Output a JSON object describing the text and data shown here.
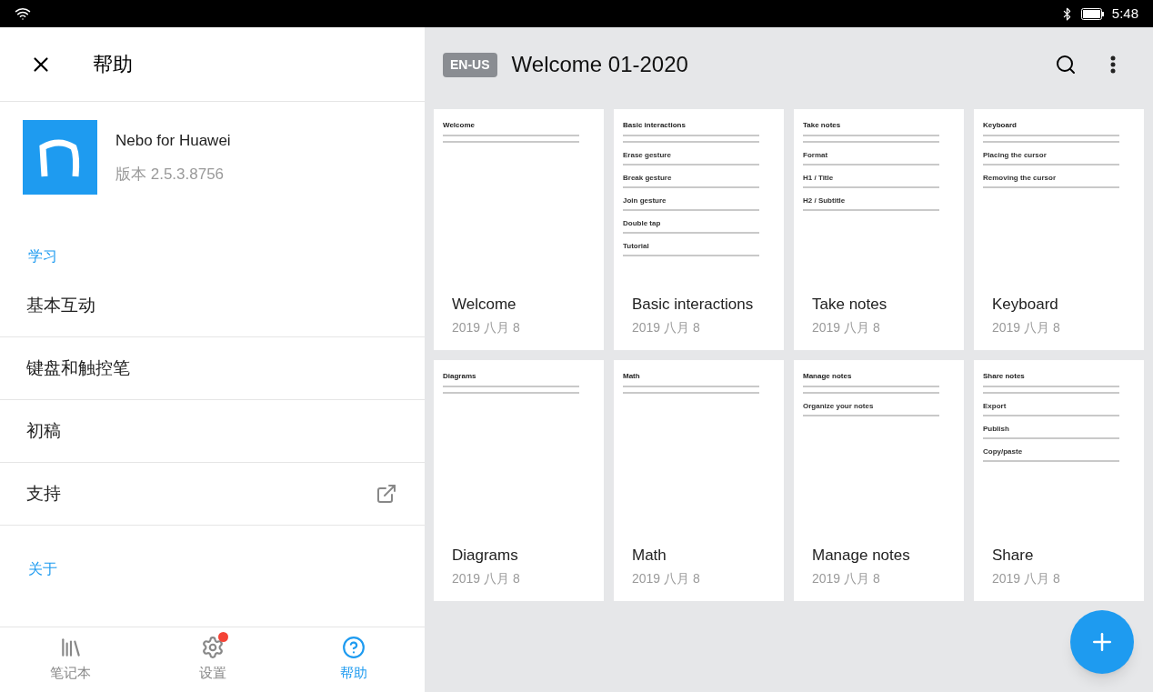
{
  "status_bar": {
    "time": "5:48"
  },
  "help_panel": {
    "title": "帮助",
    "app": {
      "name": "Nebo for Huawei",
      "version": "版本 2.5.3.8756"
    },
    "items": [
      {
        "kind": "section",
        "label": "学习"
      },
      {
        "kind": "item",
        "label": "基本互动"
      },
      {
        "kind": "item",
        "label": "键盘和触控笔"
      },
      {
        "kind": "item",
        "label": "初稿"
      },
      {
        "kind": "link",
        "label": "支持"
      },
      {
        "kind": "section",
        "label": "关于"
      }
    ]
  },
  "bottom_nav": [
    {
      "label": "笔记本",
      "selected": false,
      "badge": false
    },
    {
      "label": "设置",
      "selected": false,
      "badge": true
    },
    {
      "label": "帮助",
      "selected": true,
      "badge": false
    }
  ],
  "notebook": {
    "language": "EN-US",
    "title": "Welcome 01-2020",
    "pages": [
      {
        "preview_title": "Welcome",
        "title": "Welcome",
        "date": "2019 八月 8"
      },
      {
        "preview_title": "Basic interactions",
        "headings": [
          "Erase gesture",
          "Break gesture",
          "Join gesture",
          "Double tap",
          "Tutorial"
        ],
        "title": "Basic interactions",
        "date": "2019 八月 8"
      },
      {
        "preview_title": "Take notes",
        "headings": [
          "Format",
          "H1 / Title",
          "H2 / Subtitle"
        ],
        "title": "Take notes",
        "date": "2019 八月 8"
      },
      {
        "preview_title": "Keyboard",
        "headings": [
          "Placing the cursor",
          "Removing the cursor"
        ],
        "title": "Keyboard",
        "date": "2019 八月 8"
      },
      {
        "preview_title": "Diagrams",
        "title": "Diagrams",
        "date": "2019 八月 8"
      },
      {
        "preview_title": "Math",
        "title": "Math",
        "date": "2019 八月 8"
      },
      {
        "preview_title": "Manage notes",
        "headings": [
          "Organize your notes"
        ],
        "title": "Manage notes",
        "date": "2019 八月 8"
      },
      {
        "preview_title": "Share notes",
        "headings": [
          "Export",
          "Publish",
          "Copy/paste"
        ],
        "title": "Share",
        "date": "2019 八月 8"
      }
    ]
  }
}
